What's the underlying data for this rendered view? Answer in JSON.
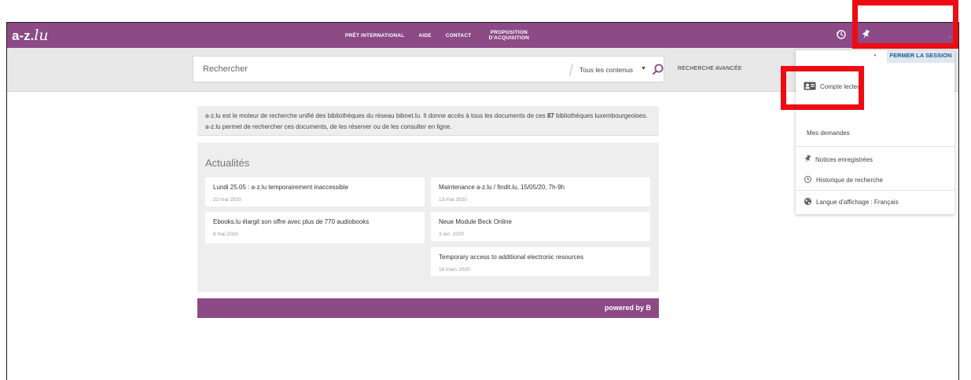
{
  "header": {
    "logo_main": "a-z.",
    "logo_suffix": "lu",
    "nav": [
      "PRÊT INTERNATIONAL",
      "AIDE",
      "CONTACT",
      "PROPOSITION D'ACQUISITION"
    ]
  },
  "search": {
    "placeholder": "Rechercher",
    "scope": "Tous les contenus",
    "advanced": "RECHERCHE AVANCÉE"
  },
  "intro": {
    "text_before": "a-z.lu est le moteur de recherche unifié des bibliothèques du réseau bibnet.lu. Il donne accès à tous les documents de ces ",
    "count": "87",
    "text_after": " bibliothèques luxembourgeoises. a-z.lu permet de rechercher ces documents, de les réserver ou de les consulter en ligne."
  },
  "news": {
    "heading": "Actualités",
    "items": [
      {
        "title": "Lundi 25.05 : a-z.lu temporairement inaccessible",
        "date": "22 mai 2020"
      },
      {
        "title": "Maintenance a-z.lu / findit.lu, 15/05/20, 7h-9h",
        "date": "13 mai 2020"
      },
      {
        "title": "Ebooks.lu élargit son offre avec plus de 770 audiobooks",
        "date": "8 mai 2020"
      },
      {
        "title": "Neue Module Beck Online",
        "date": "3 avr. 2020"
      },
      {
        "title": "Temporary access to additional electronic resources",
        "date": "18 mars 2020"
      }
    ]
  },
  "footer": {
    "powered": "powered by",
    "brand_letter": "B"
  },
  "dropdown": {
    "fermer": "FERMER LA SESSION",
    "compte": "Compte lecteur",
    "demandes": "Mes demandes",
    "notices": "Notices enregistrées",
    "historique": "Historique de recherche",
    "langue": "Langue d'affichage : Français"
  },
  "colors": {
    "brand": "#8c4a86",
    "highlight": "#ee0c13",
    "fermer_bg": "#dde8f1",
    "fermer_text": "#245a8d"
  },
  "icons": [
    "history-icon",
    "pin-icon",
    "search-icon",
    "caret-down-icon",
    "card-icon",
    "globe-icon"
  ]
}
